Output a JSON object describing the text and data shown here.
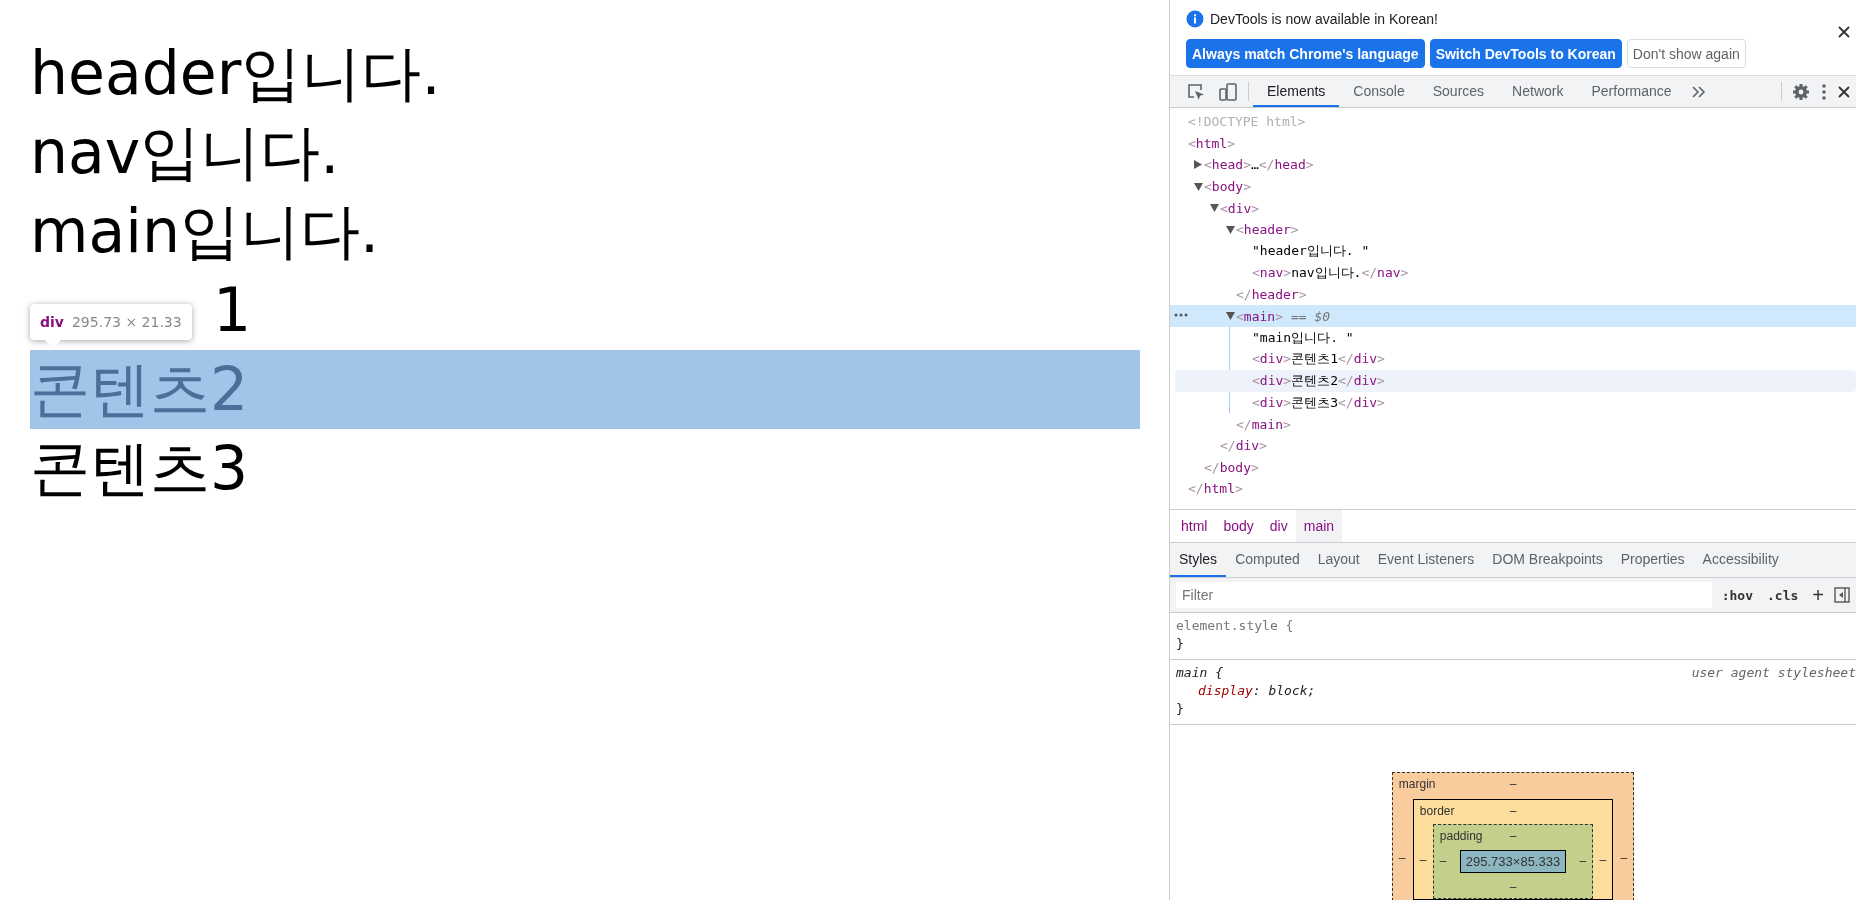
{
  "page": {
    "lines": [
      {
        "text": "header입니다.",
        "highlighted": false
      },
      {
        "text": "nav입니다.",
        "highlighted": false
      },
      {
        "text": "main입니다.",
        "highlighted": false
      },
      {
        "text": "1",
        "highlighted": false,
        "covered_by_tooltip": true
      },
      {
        "text": "콘텐츠2",
        "highlighted": true
      },
      {
        "text": "콘텐츠3",
        "highlighted": false
      }
    ],
    "tooltip": {
      "tag": "div",
      "size": "295.73 × 21.33"
    }
  },
  "devtools": {
    "infobar": {
      "message": "DevTools is now available in Korean!",
      "buttons": [
        {
          "label": "Always match Chrome's language",
          "kind": "primary"
        },
        {
          "label": "Switch DevTools to Korean",
          "kind": "primary"
        },
        {
          "label": "Don't show again",
          "kind": "secondary"
        }
      ]
    },
    "tabs": [
      {
        "label": "Elements",
        "selected": true
      },
      {
        "label": "Console",
        "selected": false
      },
      {
        "label": "Sources",
        "selected": false
      },
      {
        "label": "Network",
        "selected": false
      },
      {
        "label": "Performance",
        "selected": false
      }
    ],
    "dom_tree": [
      {
        "kind": "doctype",
        "text": "<!DOCTYPE html>",
        "selected": false,
        "hovered": false
      },
      {
        "kind": "element",
        "text": "<html>",
        "close": "</html>",
        "selected": false,
        "hovered": false,
        "children": [
          {
            "kind": "element",
            "text": "<head>…</head>",
            "expanded": false,
            "selected": false,
            "hovered": false
          },
          {
            "kind": "element",
            "text": "<body>",
            "close": "</body>",
            "expanded": true,
            "selected": false,
            "hovered": false,
            "children": [
              {
                "kind": "element",
                "text": "<div>",
                "close": "</div>",
                "expanded": true,
                "selected": false,
                "hovered": false,
                "children": [
                  {
                    "kind": "element",
                    "text": "<header>",
                    "close": "</header>",
                    "expanded": true,
                    "selected": false,
                    "hovered": false,
                    "children": [
                      {
                        "kind": "text",
                        "text": "\"header입니다. \"",
                        "selected": false,
                        "hovered": false
                      },
                      {
                        "kind": "element",
                        "text": "<nav>nav입니다.</nav>",
                        "selected": false,
                        "hovered": false
                      }
                    ]
                  },
                  {
                    "kind": "element",
                    "text": "<main>",
                    "close": "</main>",
                    "marker": "== $0",
                    "expanded": true,
                    "selected": true,
                    "hovered": false,
                    "children": [
                      {
                        "kind": "text",
                        "text": "\"main입니다. \"",
                        "selected": false,
                        "hovered": false
                      },
                      {
                        "kind": "element",
                        "text": "<div>콘텐츠1</div>",
                        "selected": false,
                        "hovered": false
                      },
                      {
                        "kind": "element",
                        "text": "<div>콘텐츠2</div>",
                        "selected": false,
                        "hovered": true
                      },
                      {
                        "kind": "element",
                        "text": "<div>콘텐츠3</div>",
                        "selected": false,
                        "hovered": false
                      }
                    ]
                  }
                ]
              }
            ]
          }
        ]
      }
    ],
    "breadcrumbs": [
      {
        "label": "html",
        "selected": false
      },
      {
        "label": "body",
        "selected": false
      },
      {
        "label": "div",
        "selected": false
      },
      {
        "label": "main",
        "selected": true
      }
    ],
    "pane_tabs": [
      {
        "label": "Styles",
        "selected": true
      },
      {
        "label": "Computed",
        "selected": false
      },
      {
        "label": "Layout",
        "selected": false
      },
      {
        "label": "Event Listeners",
        "selected": false
      },
      {
        "label": "DOM Breakpoints",
        "selected": false
      },
      {
        "label": "Properties",
        "selected": false
      },
      {
        "label": "Accessibility",
        "selected": false
      }
    ],
    "filter": {
      "placeholder": "Filter",
      "buttons": [
        ":hov",
        ".cls",
        "+"
      ]
    },
    "rules": [
      {
        "kind": "inline",
        "selector": "element.style {",
        "close": "}"
      },
      {
        "kind": "user-agent",
        "selector": "main {",
        "source": "user agent stylesheet",
        "close": "}",
        "declarations": [
          {
            "property": "display",
            "separator": ":",
            "value": "block;"
          }
        ]
      }
    ],
    "box_model": {
      "margin": {
        "label": "margin",
        "top": "–",
        "left": "–",
        "right": "–"
      },
      "border": {
        "label": "border",
        "top": "–",
        "left": "–",
        "right": "–"
      },
      "padding": {
        "label": "padding",
        "top": "–",
        "left": "–",
        "right": "–",
        "bottom": "–"
      },
      "content": "295.733×85.333"
    }
  }
}
